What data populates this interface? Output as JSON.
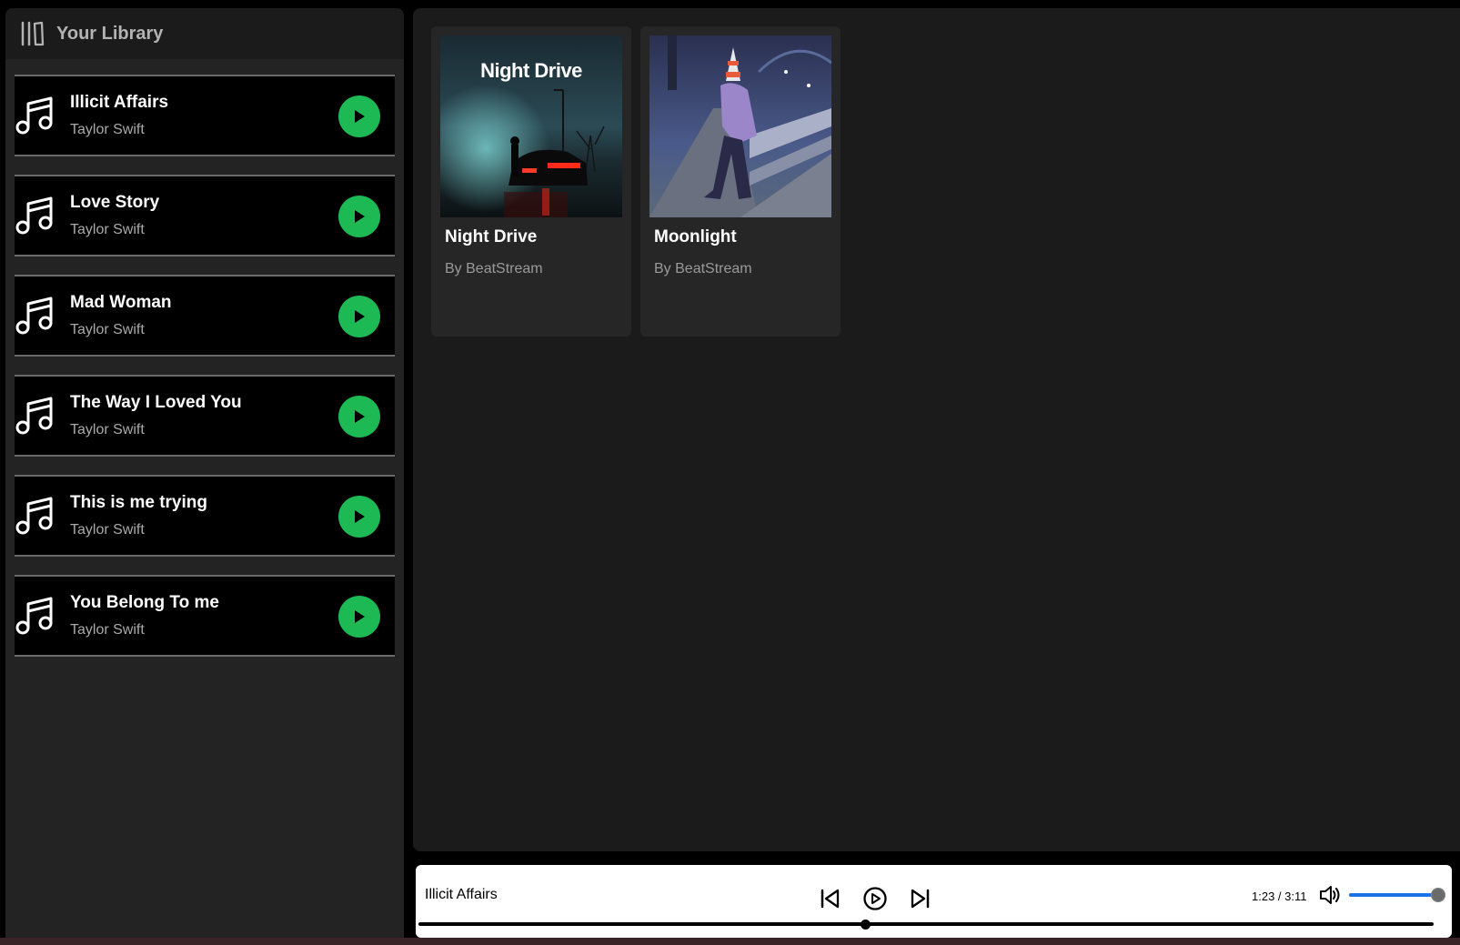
{
  "sidebar": {
    "title": "Your Library",
    "library_icon": "library-icon",
    "songs": [
      {
        "title": "Illicit Affairs",
        "artist": "Taylor Swift"
      },
      {
        "title": "Love Story",
        "artist": "Taylor Swift"
      },
      {
        "title": "Mad Woman",
        "artist": "Taylor Swift"
      },
      {
        "title": "The Way I Loved You",
        "artist": "Taylor Swift"
      },
      {
        "title": "This is me trying",
        "artist": "Taylor Swift"
      },
      {
        "title": "You Belong To me",
        "artist": "Taylor Swift"
      }
    ],
    "song_icon": "music-note-icon",
    "play_icon": "play-icon"
  },
  "playlists": [
    {
      "title": "Night Drive",
      "subtitle": "By BeatStream",
      "cover_text": "Night Drive"
    },
    {
      "title": "Moonlight",
      "subtitle": "By BeatStream"
    }
  ],
  "player": {
    "now_playing": "Illicit Affairs",
    "time": "1:23 / 3:11",
    "progress_fraction": 0.44,
    "volume_fraction": 1.0
  },
  "colors": {
    "accent_green": "#1db954",
    "sidebar_bg": "#232323",
    "main_bg": "#1b1b1b",
    "card_bg": "#262626",
    "volume_fill": "#1a73e8"
  }
}
